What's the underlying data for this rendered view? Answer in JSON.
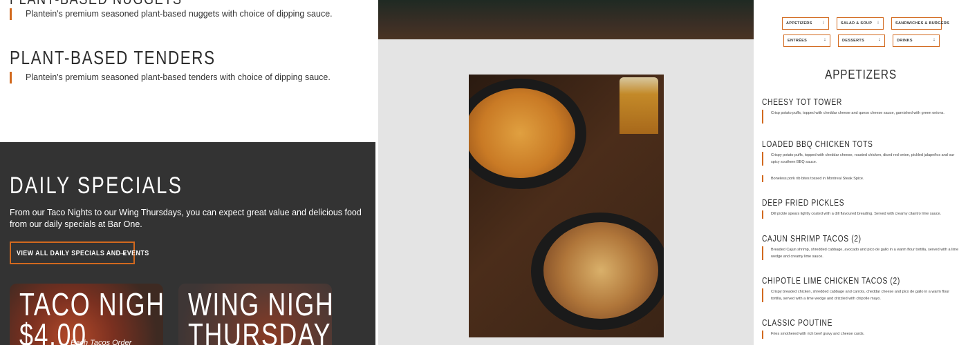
{
  "left": {
    "top_item_desc": "Plantein's premium seasoned plant-based nuggets with choice of dipping sauce.",
    "tenders_title": "PLANT-BASED TENDERS",
    "tenders_desc": "Plantein's premium seasoned plant-based tenders with choice of dipping sauce.",
    "specials": {
      "title": "DAILY SPECIALS",
      "text": "From our Taco Nights to our Wing Thursdays, you can expect great value and delicious food from our daily specials at Bar One.",
      "button_label": "VIEW ALL DAILY SPECIALS AND EVENTS",
      "button_icon": "arrow-right-icon"
    },
    "cards": [
      {
        "title_line1": "TACO NIGHTS",
        "title_line2": "$4.00",
        "sub": "Each Tacos Order"
      },
      {
        "title_line1": "WING NIGHT",
        "title_line2": "THURSDAYS"
      }
    ]
  },
  "menu": {
    "nav": [
      {
        "label": "APPETIZERS"
      },
      {
        "label": "SALAD & SOUP"
      },
      {
        "label": "SANDWICHES & BURGERS"
      },
      {
        "label": "ENTRÉES"
      },
      {
        "label": "DESSERTS"
      },
      {
        "label": "DRINKS"
      }
    ],
    "heading": "APPETIZERS",
    "items": [
      {
        "title": "CHEESY TOT TOWER",
        "desc": "Crisp potato puffs, topped with cheddar cheese and queso cheese sauce, garnished with green onions."
      },
      {
        "title": "LOADED BBQ CHICKEN TOTS",
        "desc": "Crispy potato puffs, topped with cheddar cheese, roasted chicken, diced red onion, pickled jalapeños and our spicy southern BBQ sauce."
      },
      {
        "title": "",
        "desc": "Boneless pork rib bites tossed in Montreal Steak Spice."
      },
      {
        "title": "DEEP FRIED PICKLES",
        "desc": "Dill pickle spears lightly coated with a dill flavoured breading. Served with creamy cilantro lime sauce."
      },
      {
        "title": "CAJUN SHRIMP TACOS (2)",
        "desc": "Breaded Cajun shrimp, shredded cabbage, avocado and pico de gallo in a warm flour tortilla, served with a lime wedge and creamy lime sauce."
      },
      {
        "title": "CHIPOTLE LIME CHICKEN TACOS (2)",
        "desc": "Crispy breaded chicken, shredded cabbage and carrots, cheddar cheese and pico de gallo in a warm flour tortilla, served with a lime wedge and drizzled with chipotle mayo."
      },
      {
        "title": "CLASSIC POUTINE",
        "desc": "Fries smothered with rich beef gravy and cheese curds."
      }
    ]
  },
  "colors": {
    "accent": "#d2691e",
    "dark": "#333333",
    "mid_bg": "#e4e4e4"
  }
}
